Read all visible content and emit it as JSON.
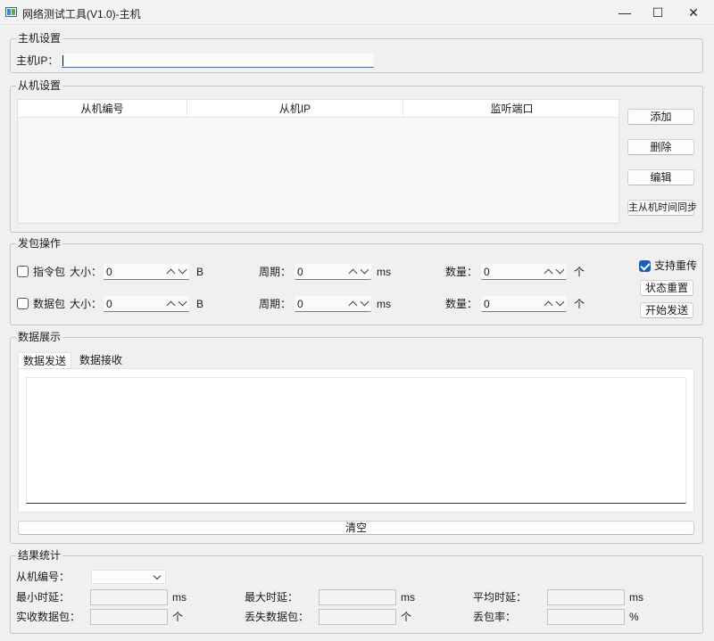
{
  "window": {
    "title": "网络测试工具(V1.0)-主机",
    "minimize": "—",
    "maximize": "☐",
    "close": "✕"
  },
  "host_settings": {
    "group_title": "主机设置",
    "host_ip_label": "主机IP：",
    "host_ip_value": ""
  },
  "slave_settings": {
    "group_title": "从机设置",
    "columns": [
      "从机编号",
      "从机IP",
      "监听端口"
    ],
    "buttons": {
      "add": "添加",
      "delete": "删除",
      "edit": "编辑",
      "sync": "主从机时间同步"
    }
  },
  "send_ops": {
    "group_title": "发包操作",
    "rows": [
      {
        "checkbox_label": "指令包",
        "size_label": "大小：",
        "size_value": "0",
        "size_unit": "B",
        "period_label": "周期：",
        "period_value": "0",
        "period_unit": "ms",
        "count_label": "数量：",
        "count_value": "0",
        "count_unit": "个"
      },
      {
        "checkbox_label": "数据包",
        "size_label": "大小：",
        "size_value": "0",
        "size_unit": "B",
        "period_label": "周期：",
        "period_value": "0",
        "period_unit": "ms",
        "count_label": "数量：",
        "count_value": "0",
        "count_unit": "个"
      }
    ],
    "retransmit_label": "支持重传",
    "reset_button": "状态重置",
    "start_button": "开始发送"
  },
  "data_display": {
    "group_title": "数据展示",
    "tabs": [
      "数据发送",
      "数据接收"
    ],
    "clear_button": "清空"
  },
  "stats": {
    "group_title": "结果统计",
    "slave_no_label": "从机编号：",
    "slave_no_value": "",
    "min_delay_label": "最小时延：",
    "min_delay_unit": "ms",
    "max_delay_label": "最大时延：",
    "max_delay_unit": "ms",
    "avg_delay_label": "平均时延：",
    "avg_delay_unit": "ms",
    "recv_label": "实收数据包：",
    "recv_unit": "个",
    "lost_label": "丢失数据包：",
    "lost_unit": "个",
    "loss_rate_label": "丢包率：",
    "loss_rate_unit": "%"
  }
}
